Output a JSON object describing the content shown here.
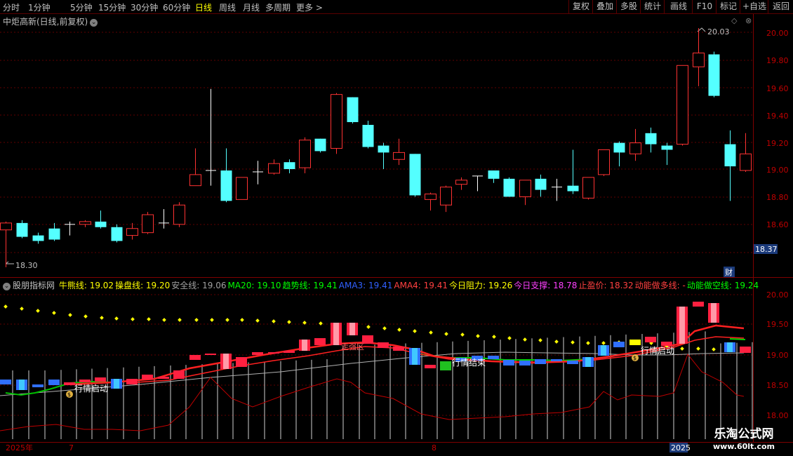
{
  "toolbar": {
    "tabs": [
      "分时",
      "1分钟",
      "5分钟",
      "15分钟",
      "30分钟",
      "60分钟",
      "日线",
      "周线",
      "月线",
      "多周期",
      "更多 >"
    ],
    "active_tab": "日线",
    "right_buttons": [
      "复权",
      "叠加",
      "多股",
      "统计",
      "画线",
      "F10",
      "+自选",
      "返回"
    ]
  },
  "main_chart": {
    "title": "中炬高新(日线,前复权)",
    "y_labels": [
      "20.00",
      "19.80",
      "19.60",
      "19.40",
      "19.20",
      "19.00",
      "18.80",
      "18.60"
    ],
    "high_label": "20.03",
    "low_label": "18.30",
    "current_price_tag": "18.37",
    "finance_icon_text": "财"
  },
  "indicator": {
    "title": "股朋指标网",
    "values": [
      {
        "label": "牛熊线: ",
        "value": "19.02",
        "color": "#ffff00"
      },
      {
        "label": "操盘线: ",
        "value": "19.20",
        "color": "#ffff00"
      },
      {
        "label": "安全线: ",
        "value": "19.06",
        "color": "#a0a0a0"
      },
      {
        "label": "MA20: ",
        "value": "19.10",
        "color": "#00ff00"
      },
      {
        "label": "趋势线: ",
        "value": "19.41",
        "color": "#00ff00"
      },
      {
        "label": "AMA3: ",
        "value": "19.41",
        "color": "#3060ff"
      },
      {
        "label": "AMA4: ",
        "value": "19.41",
        "color": "#ff4040"
      },
      {
        "label": "今日阻力: ",
        "value": "19.26",
        "color": "#ffff00"
      },
      {
        "label": "今日支撑: ",
        "value": "18.78",
        "color": "#ff40ff"
      },
      {
        "label": "止盈价: ",
        "value": "18.32",
        "color": "#ff4040"
      },
      {
        "label": "动能做多线: ",
        "value": "-",
        "color": "#ff4040"
      },
      {
        "label": "动能做空线: ",
        "value": "19.24",
        "color": "#00ff00"
      }
    ],
    "y_labels": [
      "20.00",
      "19.50",
      "19.00",
      "18.50",
      "18.00"
    ],
    "annotations": [
      "行情启动",
      "走强区",
      "行情结束",
      "行情启动"
    ]
  },
  "date_axis": {
    "labels": [
      "2025年",
      "7",
      "8",
      "2025"
    ]
  },
  "watermark": {
    "line1": "乐淘公式网",
    "line2": "www.60lt.com"
  },
  "colors": {
    "up": "#ff3232",
    "down": "#54ffff",
    "grid": "#800000",
    "highlight": "#ffff00"
  }
}
